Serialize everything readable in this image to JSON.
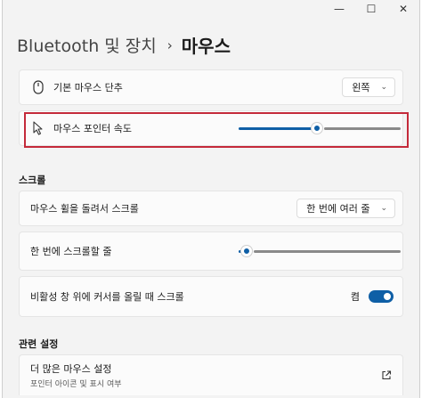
{
  "window": {
    "minimize": "—",
    "maximize": "☐",
    "close": "✕"
  },
  "breadcrumb": {
    "parent": "Bluetooth 및 장치",
    "separator": "›",
    "current": "마우스"
  },
  "primary_button": {
    "label": "기본 마우스 단추",
    "value": "왼쪽"
  },
  "pointer_speed": {
    "label": "마우스 포인터 속도",
    "value_fraction": 0.48
  },
  "scroll_section": {
    "title": "스크롤",
    "wheel": {
      "label": "마우스 휠을 돌려서 스크롤",
      "value": "한 번에 여러 줄"
    },
    "lines": {
      "label": "한 번에 스크롤할 줄",
      "value_fraction": 0.02
    },
    "inactive": {
      "label": "비활성 창 위에 커서를 올릴 때 스크롤",
      "state": "켬",
      "on": true
    }
  },
  "related": {
    "title": "관련 설정",
    "more_mouse": {
      "label": "더 많은 마우스 설정",
      "sub": "포인터 아이콘 및 표시 여부"
    }
  },
  "colors": {
    "accent": "#0f5fa6",
    "highlight": "#c42a3a"
  }
}
